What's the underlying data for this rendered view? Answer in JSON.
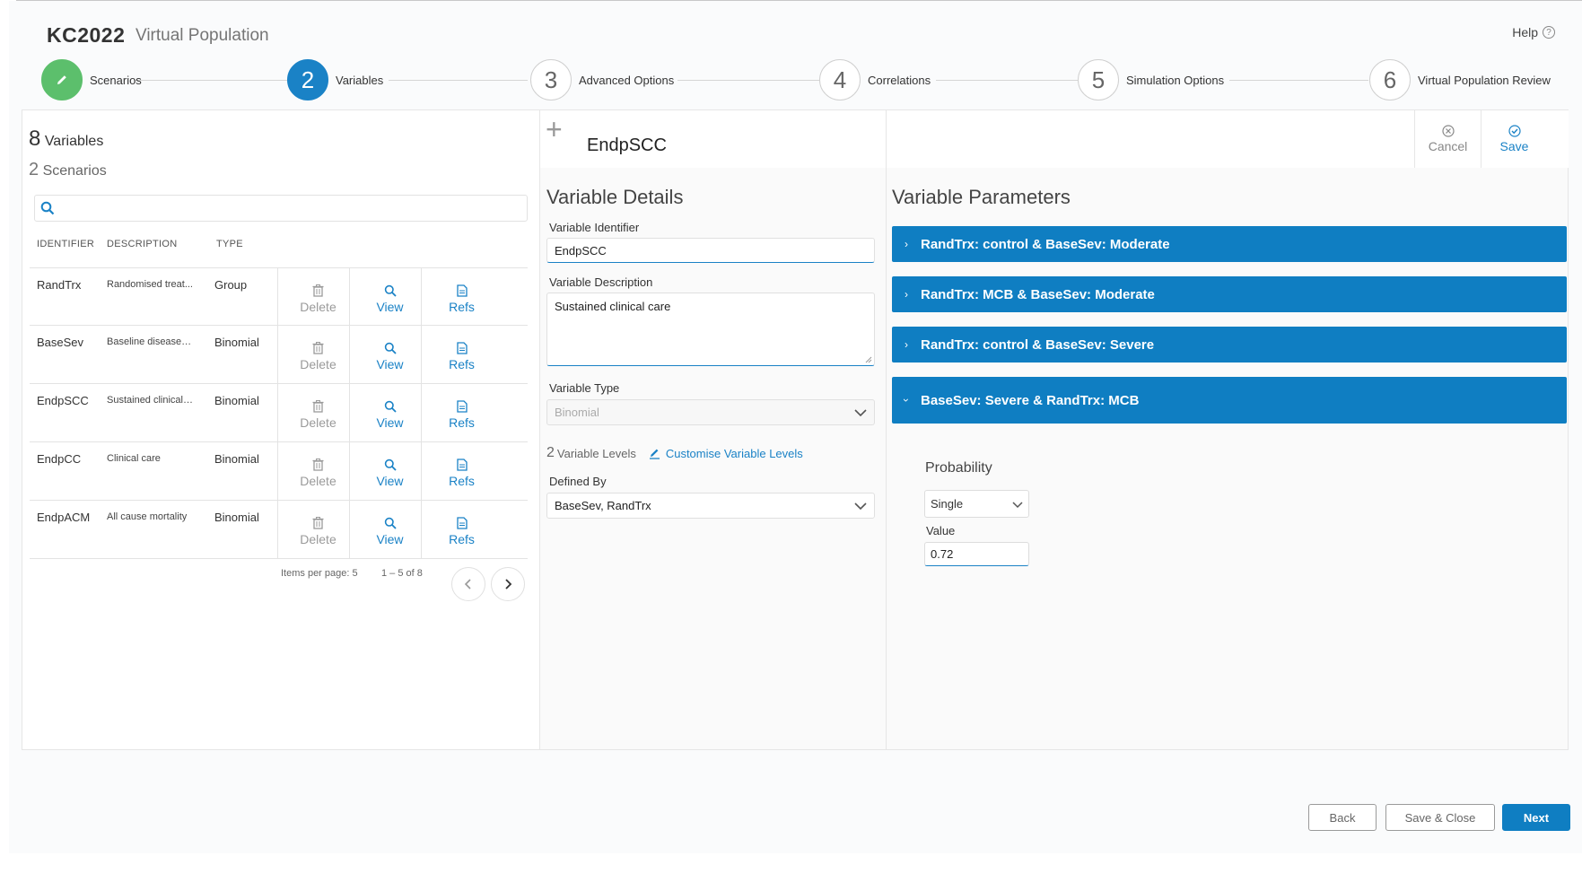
{
  "app": {
    "brand": "KC2022",
    "subtitle": "Virtual Population",
    "help_label": "Help"
  },
  "stepper": [
    {
      "number": "",
      "label": "Scenarios",
      "state": "done"
    },
    {
      "number": "2",
      "label": "Variables",
      "state": "active"
    },
    {
      "number": "3",
      "label": "Advanced Options",
      "state": "pending"
    },
    {
      "number": "4",
      "label": "Correlations",
      "state": "pending"
    },
    {
      "number": "5",
      "label": "Simulation Options",
      "state": "pending"
    },
    {
      "number": "6",
      "label": "Virtual Population Review",
      "state": "pending"
    }
  ],
  "left": {
    "variables_count": "8",
    "variables_label": "Variables",
    "scenarios_count": "2",
    "scenarios_label": "Scenarios",
    "search_placeholder": "",
    "columns": {
      "identifier": "IDENTIFIER",
      "description": "DESCRIPTION",
      "type": "TYPE"
    },
    "rows": [
      {
        "id": "RandTrx",
        "desc": "Randomised treat...",
        "type": "Group"
      },
      {
        "id": "BaseSev",
        "desc": "Baseline disease s...",
        "type": "Binomial"
      },
      {
        "id": "EndpSCC",
        "desc": "Sustained clinical ...",
        "type": "Binomial"
      },
      {
        "id": "EndpCC",
        "desc": "Clinical care",
        "type": "Binomial"
      },
      {
        "id": "EndpACM",
        "desc": "All cause mortality",
        "type": "Binomial"
      }
    ],
    "actions": {
      "delete": "Delete",
      "view": "View",
      "refs": "Refs"
    },
    "pagination": {
      "items_per_page": "Items per page: 5",
      "range": "1 – 5 of 8"
    }
  },
  "middle": {
    "variable_title": "EndpSCC",
    "section_title": "Variable Details",
    "identifier_label": "Variable Identifier",
    "identifier_value": "EndpSCC",
    "description_label": "Variable Description",
    "description_value": "Sustained clinical care",
    "type_label": "Variable Type",
    "type_value": "Binomial",
    "levels_count": "2",
    "levels_label": "Variable Levels",
    "customise_label": "Customise Variable Levels",
    "defined_by_label": "Defined By",
    "defined_by_value": "BaseSev, RandTrx"
  },
  "right": {
    "cancel_label": "Cancel",
    "save_label": "Save",
    "section_title": "Variable Parameters",
    "panels": [
      {
        "title": "RandTrx: control & BaseSev: Moderate",
        "expanded": false
      },
      {
        "title": "RandTrx: MCB & BaseSev: Moderate",
        "expanded": false
      },
      {
        "title": "RandTrx: control & BaseSev: Severe",
        "expanded": false
      },
      {
        "title": "BaseSev: Severe & RandTrx: MCB",
        "expanded": true
      }
    ],
    "probability_label": "Probability",
    "probability_mode": "Single",
    "value_label": "Value",
    "value": "0.72"
  },
  "footer": {
    "back": "Back",
    "save_close": "Save & Close",
    "next": "Next"
  },
  "colors": {
    "primary": "#0f7ec2",
    "success": "#5cbf6c",
    "border": "#e6e6e6"
  }
}
